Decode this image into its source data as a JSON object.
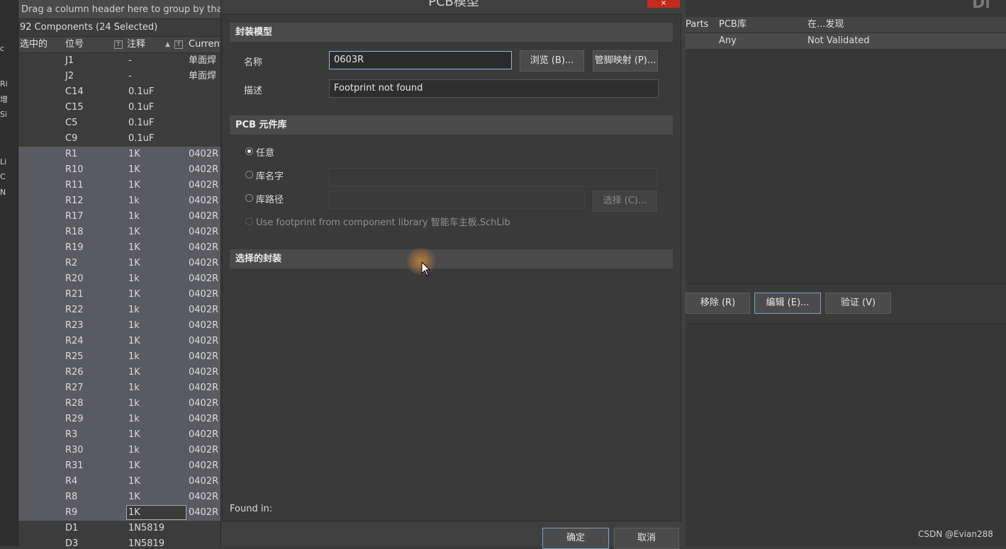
{
  "left_strip": {
    "glyphs": [
      "c",
      "Ri",
      "增",
      "Si",
      "Li",
      "C",
      "N"
    ]
  },
  "grid": {
    "group_hint": "Drag a column header here to group by that column",
    "count_text": "92 Components (24 Selected)",
    "columns": [
      "选中的",
      "位号",
      "注释",
      "Current"
    ],
    "rows": [
      {
        "designator": "J1",
        "comment": "-",
        "current": "单面焊",
        "selected": false
      },
      {
        "designator": "J2",
        "comment": "-",
        "current": "单面焊",
        "selected": false
      },
      {
        "designator": "C14",
        "comment": "0.1uF",
        "current": "",
        "selected": false
      },
      {
        "designator": "C15",
        "comment": "0.1uF",
        "current": "",
        "selected": false
      },
      {
        "designator": "C5",
        "comment": "0.1uF",
        "current": "",
        "selected": false
      },
      {
        "designator": "C9",
        "comment": "0.1uF",
        "current": "",
        "selected": false
      },
      {
        "designator": "R1",
        "comment": "1K",
        "current": "0402R",
        "selected": true
      },
      {
        "designator": "R10",
        "comment": "1K",
        "current": "0402R",
        "selected": true
      },
      {
        "designator": "R11",
        "comment": "1K",
        "current": "0402R",
        "selected": true
      },
      {
        "designator": "R12",
        "comment": "1k",
        "current": "0402R",
        "selected": true
      },
      {
        "designator": "R17",
        "comment": "1k",
        "current": "0402R",
        "selected": true
      },
      {
        "designator": "R18",
        "comment": "1K",
        "current": "0402R",
        "selected": true
      },
      {
        "designator": "R19",
        "comment": "1K",
        "current": "0402R",
        "selected": true
      },
      {
        "designator": "R2",
        "comment": "1K",
        "current": "0402R",
        "selected": true
      },
      {
        "designator": "R20",
        "comment": "1k",
        "current": "0402R",
        "selected": true
      },
      {
        "designator": "R21",
        "comment": "1K",
        "current": "0402R",
        "selected": true
      },
      {
        "designator": "R22",
        "comment": "1k",
        "current": "0402R",
        "selected": true
      },
      {
        "designator": "R23",
        "comment": "1k",
        "current": "0402R",
        "selected": true
      },
      {
        "designator": "R24",
        "comment": "1K",
        "current": "0402R",
        "selected": true
      },
      {
        "designator": "R25",
        "comment": "1k",
        "current": "0402R",
        "selected": true
      },
      {
        "designator": "R26",
        "comment": "1K",
        "current": "0402R",
        "selected": true
      },
      {
        "designator": "R27",
        "comment": "1k",
        "current": "0402R",
        "selected": true
      },
      {
        "designator": "R28",
        "comment": "1k",
        "current": "0402R",
        "selected": true
      },
      {
        "designator": "R29",
        "comment": "1k",
        "current": "0402R",
        "selected": true
      },
      {
        "designator": "R3",
        "comment": "1K",
        "current": "0402R",
        "selected": true
      },
      {
        "designator": "R30",
        "comment": "1k",
        "current": "0402R",
        "selected": true
      },
      {
        "designator": "R31",
        "comment": "1K",
        "current": "0402R",
        "selected": true
      },
      {
        "designator": "R4",
        "comment": "1K",
        "current": "0402R",
        "selected": true
      },
      {
        "designator": "R8",
        "comment": "1K",
        "current": "0402R",
        "selected": true
      },
      {
        "designator": "R9",
        "comment": "1K",
        "current": "0402R",
        "selected": true,
        "editing": true
      },
      {
        "designator": "D1",
        "comment": "1N5819",
        "current": "",
        "selected": false
      },
      {
        "designator": "D3",
        "comment": "1N5819",
        "current": "",
        "selected": false
      }
    ]
  },
  "dialog": {
    "title": "PCB模型",
    "close_glyph": "×",
    "section_footprint": "封装模型",
    "name_label": "名称",
    "name_value": "0603R",
    "browse_button": "浏览 (B)...",
    "pinmap_button": "管脚映射 (P)...",
    "desc_label": "描述",
    "desc_value": "Footprint not found",
    "section_library": "PCB 元件库",
    "radio_any": "任意",
    "radio_libname": "库名字",
    "radio_libpath": "库路径",
    "choose_button": "选择 (C)...",
    "use_from_lib": "Use footprint from component library 智能车主板.SchLib",
    "section_selected": "选择的封装",
    "found_in": "Found in:",
    "ok_button": "确定",
    "cancel_button": "取消"
  },
  "right": {
    "logo_fragment": "Di",
    "columns": [
      "Parts",
      "PCB库",
      "在...发现"
    ],
    "row": {
      "pcb_lib": "Any",
      "found": "Not Validated"
    },
    "remove_button": "移除 (R)",
    "edit_button": "编辑 (E)...",
    "validate_button": "验证 (V)"
  },
  "watermark": "CSDN @Evian288",
  "colors": {
    "selected_row": "#5a5a61",
    "focus_border": "#9ab4d4",
    "close_red": "#c42b1c"
  }
}
